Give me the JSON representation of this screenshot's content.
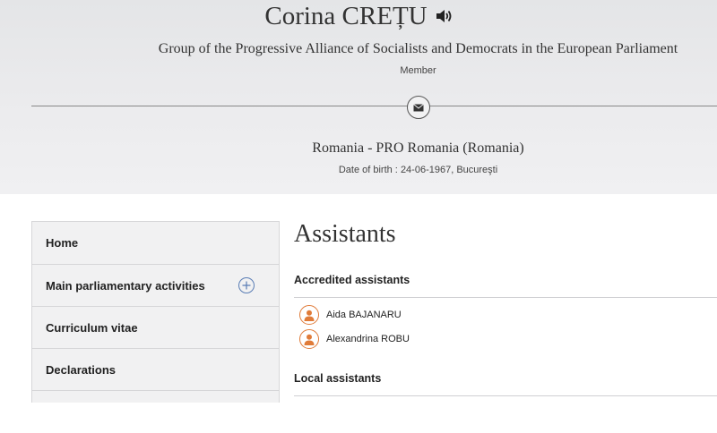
{
  "profile": {
    "name": "Corina CREȚU",
    "group": "Group of the Progressive Alliance of Socialists and Democrats in the European Parliament",
    "role": "Member",
    "country": "Romania - PRO Romania (Romania)",
    "dob_label": "Date of birth :",
    "dob_value": "24-06-1967, Bucureşti"
  },
  "icons": {
    "speaker": "speaker-icon",
    "mail": "envelope-icon",
    "expand": "plus-circle-icon",
    "avatar": "person-icon"
  },
  "sidebar": {
    "items": [
      {
        "label": "Home"
      },
      {
        "label": "Main parliamentary activities"
      },
      {
        "label": "Curriculum vitae"
      },
      {
        "label": "Declarations"
      },
      {
        "label": ""
      }
    ]
  },
  "main": {
    "title": "Assistants",
    "accredited_title": "Accredited assistants",
    "accredited": [
      {
        "name": "Aida BAJANARU"
      },
      {
        "name": "Alexandrina ROBU"
      }
    ],
    "local_title": "Local assistants"
  },
  "colors": {
    "accent_orange": "#e07b39",
    "accent_blue": "#5a7db5",
    "header_bg": "#e8e9eb"
  }
}
